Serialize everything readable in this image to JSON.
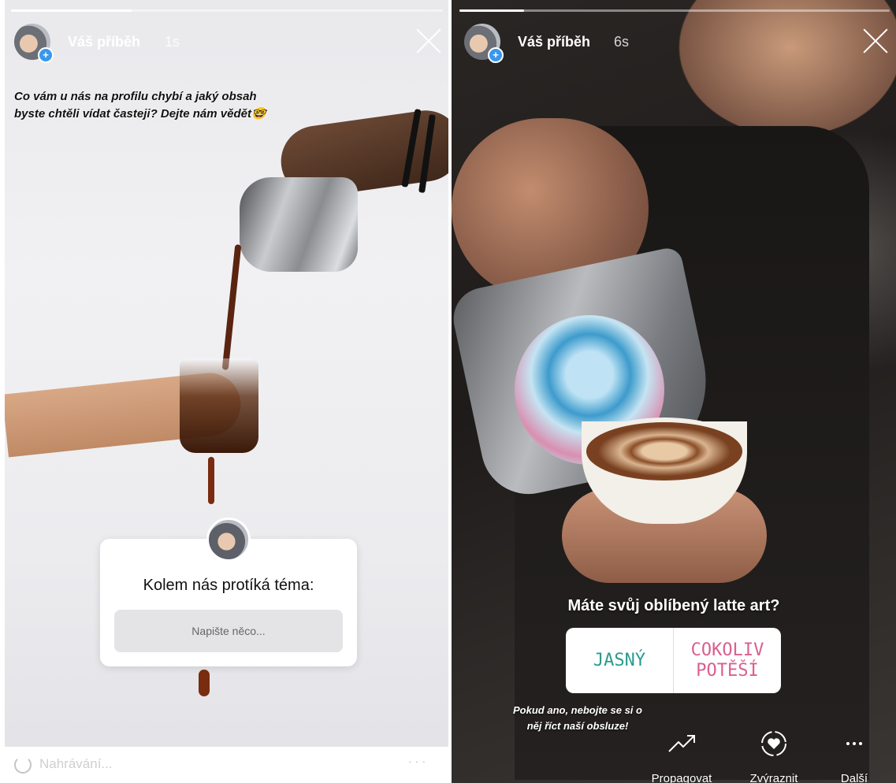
{
  "left_story": {
    "username": "Váš příběh",
    "time": "1s",
    "progress": 0.28,
    "question": "Co vám u nás na profilu chybí a jaký obsah byste chtěli vídat časteji? Dejte nám vědět🤓",
    "question_box": {
      "title": "Kolem nás protíká téma:",
      "input_placeholder": "Napište něco..."
    },
    "uploading": "Nahrávání...",
    "more_glyph": "···"
  },
  "right_story": {
    "username": "Váš příběh",
    "time": "6s",
    "progress": 0.15,
    "poll_question": "Máte svůj oblíbený latte art?",
    "poll_options": [
      "JASNÝ",
      "COKOLIV\nPOTĚŠÍ"
    ],
    "caption_line1": "Pokud ano, nebojte se si o",
    "caption_line2": "něj říct naší obsluze!",
    "actions": [
      {
        "label": "Propagovat",
        "icon": "trending-up-icon"
      },
      {
        "label": "Zvýraznit",
        "icon": "heart-circle-icon"
      },
      {
        "label": "Další",
        "icon": "more-icon"
      }
    ]
  },
  "colors": {
    "accent_blue": "#3897f0",
    "poll_left": "#2a9b8e",
    "poll_right": "#d95f8f"
  }
}
